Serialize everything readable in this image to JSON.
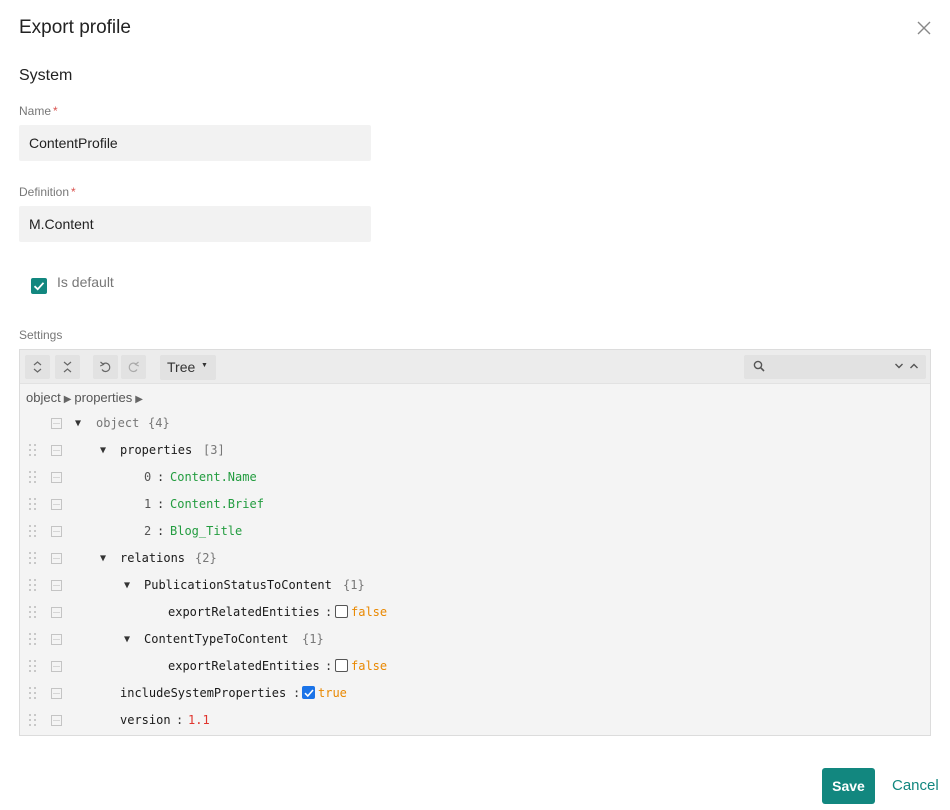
{
  "dialog": {
    "title": "Export profile",
    "close_icon": "close-icon"
  },
  "section": {
    "title": "System"
  },
  "name_field": {
    "label": "Name",
    "required": "*",
    "value": "ContentProfile"
  },
  "definition_field": {
    "label": "Definition",
    "required": "*",
    "value": "M.Content"
  },
  "is_default": {
    "label": "Is default",
    "checked": true
  },
  "settings": {
    "label": "Settings",
    "toolbar": {
      "expand_all_icon": "expand-all-icon",
      "collapse_all_icon": "collapse-all-icon",
      "undo_icon": "undo-icon",
      "redo_icon": "redo-icon",
      "mode": "Tree",
      "search_icon": "search-icon",
      "search_value": ""
    },
    "breadcrumb": [
      "object",
      "properties"
    ],
    "tree": {
      "root_key": "object",
      "root_count": "{4}",
      "properties_key": "properties",
      "properties_count": "[3]",
      "properties_items": [
        {
          "index": "0",
          "value": "Content.Name"
        },
        {
          "index": "1",
          "value": "Content.Brief"
        },
        {
          "index": "2",
          "value": "Blog_Title"
        }
      ],
      "relations_key": "relations",
      "relations_count": "{2}",
      "relation1_key": "PublicationStatusToContent",
      "relation1_count": "{1}",
      "relation1_prop": "exportRelatedEntities",
      "relation1_value": "false",
      "relation2_key": "ContentTypeToContent",
      "relation2_count": "{1}",
      "relation2_prop": "exportRelatedEntities",
      "relation2_value": "false",
      "include_system_key": "includeSystemProperties",
      "include_system_value": "true",
      "version_key": "version",
      "version_value": "1.1"
    }
  },
  "footer": {
    "save": "Save",
    "cancel": "Cancel"
  },
  "colors": {
    "accent": "#12877f",
    "string": "#229c3f",
    "number": "#e0342d",
    "boolean": "#e98800"
  }
}
